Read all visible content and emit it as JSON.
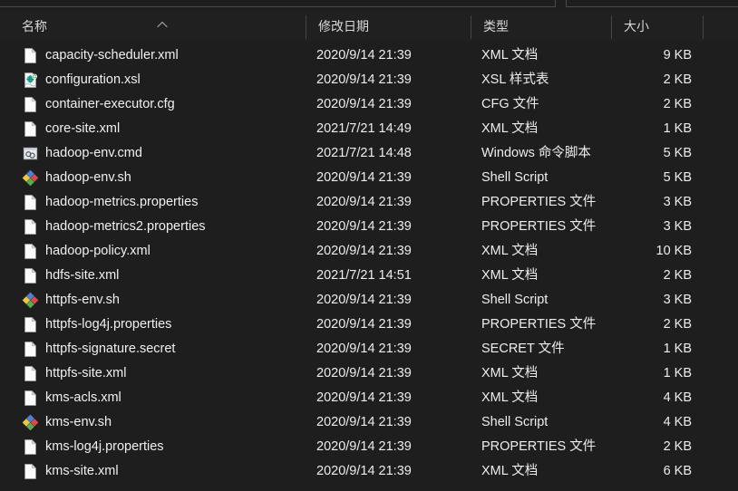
{
  "window": {
    "app": "file-explorer",
    "theme": "dark",
    "background_color": "#1e1e1e",
    "text_color": "#f0f0f0"
  },
  "columns": [
    {
      "key": "name",
      "label": "名称",
      "sorted": true,
      "sort_direction": "ascending",
      "sort_indicator": "chevron-up-icon"
    },
    {
      "key": "date",
      "label": "修改日期",
      "sorted": false
    },
    {
      "key": "type",
      "label": "类型",
      "sorted": false
    },
    {
      "key": "size",
      "label": "大小",
      "sorted": false
    }
  ],
  "files": [
    {
      "name": "capacity-scheduler.xml",
      "date": "2020/9/14 21:39",
      "type": "XML 文档",
      "size": "9 KB",
      "icon": "generic-file-icon"
    },
    {
      "name": "configuration.xsl",
      "date": "2020/9/14 21:39",
      "type": "XSL 样式表",
      "size": "2 KB",
      "icon": "xsl-stylesheet-icon"
    },
    {
      "name": "container-executor.cfg",
      "date": "2020/9/14 21:39",
      "type": "CFG 文件",
      "size": "2 KB",
      "icon": "generic-file-icon"
    },
    {
      "name": "core-site.xml",
      "date": "2021/7/21 14:49",
      "type": "XML 文档",
      "size": "1 KB",
      "icon": "generic-file-icon"
    },
    {
      "name": "hadoop-env.cmd",
      "date": "2021/7/21 14:48",
      "type": "Windows 命令脚本",
      "size": "5 KB",
      "icon": "windows-command-script-icon"
    },
    {
      "name": "hadoop-env.sh",
      "date": "2020/9/14 21:39",
      "type": "Shell Script",
      "size": "5 KB",
      "icon": "shell-script-icon"
    },
    {
      "name": "hadoop-metrics.properties",
      "date": "2020/9/14 21:39",
      "type": "PROPERTIES 文件",
      "size": "3 KB",
      "icon": "generic-file-icon"
    },
    {
      "name": "hadoop-metrics2.properties",
      "date": "2020/9/14 21:39",
      "type": "PROPERTIES 文件",
      "size": "3 KB",
      "icon": "generic-file-icon"
    },
    {
      "name": "hadoop-policy.xml",
      "date": "2020/9/14 21:39",
      "type": "XML 文档",
      "size": "10 KB",
      "icon": "generic-file-icon"
    },
    {
      "name": "hdfs-site.xml",
      "date": "2021/7/21 14:51",
      "type": "XML 文档",
      "size": "2 KB",
      "icon": "generic-file-icon"
    },
    {
      "name": "httpfs-env.sh",
      "date": "2020/9/14 21:39",
      "type": "Shell Script",
      "size": "3 KB",
      "icon": "shell-script-icon"
    },
    {
      "name": "httpfs-log4j.properties",
      "date": "2020/9/14 21:39",
      "type": "PROPERTIES 文件",
      "size": "2 KB",
      "icon": "generic-file-icon"
    },
    {
      "name": "httpfs-signature.secret",
      "date": "2020/9/14 21:39",
      "type": "SECRET 文件",
      "size": "1 KB",
      "icon": "generic-file-icon"
    },
    {
      "name": "httpfs-site.xml",
      "date": "2020/9/14 21:39",
      "type": "XML 文档",
      "size": "1 KB",
      "icon": "generic-file-icon"
    },
    {
      "name": "kms-acls.xml",
      "date": "2020/9/14 21:39",
      "type": "XML 文档",
      "size": "4 KB",
      "icon": "generic-file-icon"
    },
    {
      "name": "kms-env.sh",
      "date": "2020/9/14 21:39",
      "type": "Shell Script",
      "size": "4 KB",
      "icon": "shell-script-icon"
    },
    {
      "name": "kms-log4j.properties",
      "date": "2020/9/14 21:39",
      "type": "PROPERTIES 文件",
      "size": "2 KB",
      "icon": "generic-file-icon"
    },
    {
      "name": "kms-site.xml",
      "date": "2020/9/14 21:39",
      "type": "XML 文档",
      "size": "6 KB",
      "icon": "generic-file-icon"
    }
  ]
}
